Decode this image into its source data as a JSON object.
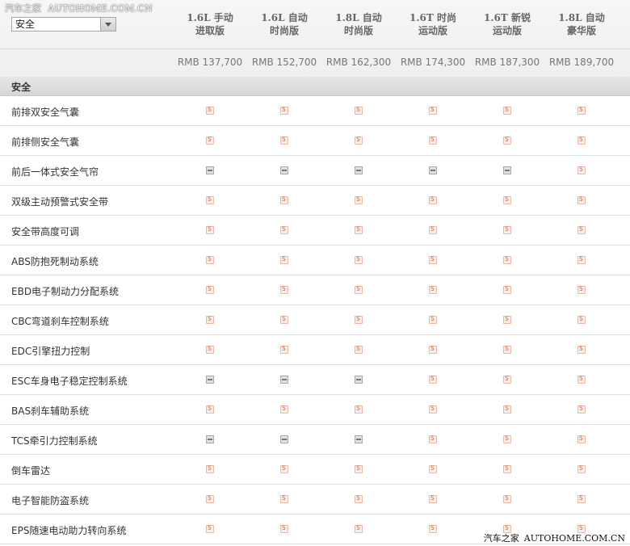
{
  "watermark_top": {
    "cn": "汽车之家",
    "en": "AUTOHOME.COM.CN"
  },
  "watermark_bottom": {
    "cn": "汽车之家",
    "en": "AUTOHOME.COM.CN"
  },
  "category_select": {
    "value": "安全"
  },
  "models": [
    {
      "line1": "1.6L 手动",
      "line2": "进取版",
      "price": "RMB 137,700"
    },
    {
      "line1": "1.6L 自动",
      "line2": "时尚版",
      "price": "RMB 152,700"
    },
    {
      "line1": "1.8L 自动",
      "line2": "时尚版",
      "price": "RMB 162,300"
    },
    {
      "line1": "1.6T 时尚",
      "line2": "运动版",
      "price": "RMB 174,300"
    },
    {
      "line1": "1.6T 新锐",
      "line2": "运动版",
      "price": "RMB 187,300"
    },
    {
      "line1": "1.8L 自动",
      "line2": "豪华版",
      "price": "RMB 189,700"
    }
  ],
  "section_title": "安全",
  "legend": {
    "standard": "S",
    "none": "-"
  },
  "rows": [
    {
      "label": "前排双安全气囊",
      "values": [
        "S",
        "S",
        "S",
        "S",
        "S",
        "S"
      ]
    },
    {
      "label": "前排侧安全气囊",
      "values": [
        "S",
        "S",
        "S",
        "S",
        "S",
        "S"
      ]
    },
    {
      "label": "前后一体式安全气帘",
      "values": [
        "-",
        "-",
        "-",
        "-",
        "-",
        "S"
      ]
    },
    {
      "label": "双级主动预警式安全带",
      "values": [
        "S",
        "S",
        "S",
        "S",
        "S",
        "S"
      ]
    },
    {
      "label": "安全带高度可调",
      "values": [
        "S",
        "S",
        "S",
        "S",
        "S",
        "S"
      ]
    },
    {
      "label": "ABS防抱死制动系统",
      "values": [
        "S",
        "S",
        "S",
        "S",
        "S",
        "S"
      ]
    },
    {
      "label": "EBD电子制动力分配系统",
      "values": [
        "S",
        "S",
        "S",
        "S",
        "S",
        "S"
      ]
    },
    {
      "label": "CBC弯道刹车控制系统",
      "values": [
        "S",
        "S",
        "S",
        "S",
        "S",
        "S"
      ]
    },
    {
      "label": "EDC引擎扭力控制",
      "values": [
        "S",
        "S",
        "S",
        "S",
        "S",
        "S"
      ]
    },
    {
      "label": "ESC车身电子稳定控制系统",
      "values": [
        "-",
        "-",
        "-",
        "S",
        "S",
        "S"
      ]
    },
    {
      "label": "BAS刹车辅助系统",
      "values": [
        "S",
        "S",
        "S",
        "S",
        "S",
        "S"
      ]
    },
    {
      "label": "TCS牵引力控制系统",
      "values": [
        "-",
        "-",
        "-",
        "S",
        "S",
        "S"
      ]
    },
    {
      "label": "倒车雷达",
      "values": [
        "S",
        "S",
        "S",
        "S",
        "S",
        "S"
      ]
    },
    {
      "label": "电子智能防盗系统",
      "values": [
        "S",
        "S",
        "S",
        "S",
        "S",
        "S"
      ]
    },
    {
      "label": "EPS随速电动助力转向系统",
      "values": [
        "S",
        "S",
        "S",
        "S",
        "S",
        "S"
      ]
    }
  ]
}
